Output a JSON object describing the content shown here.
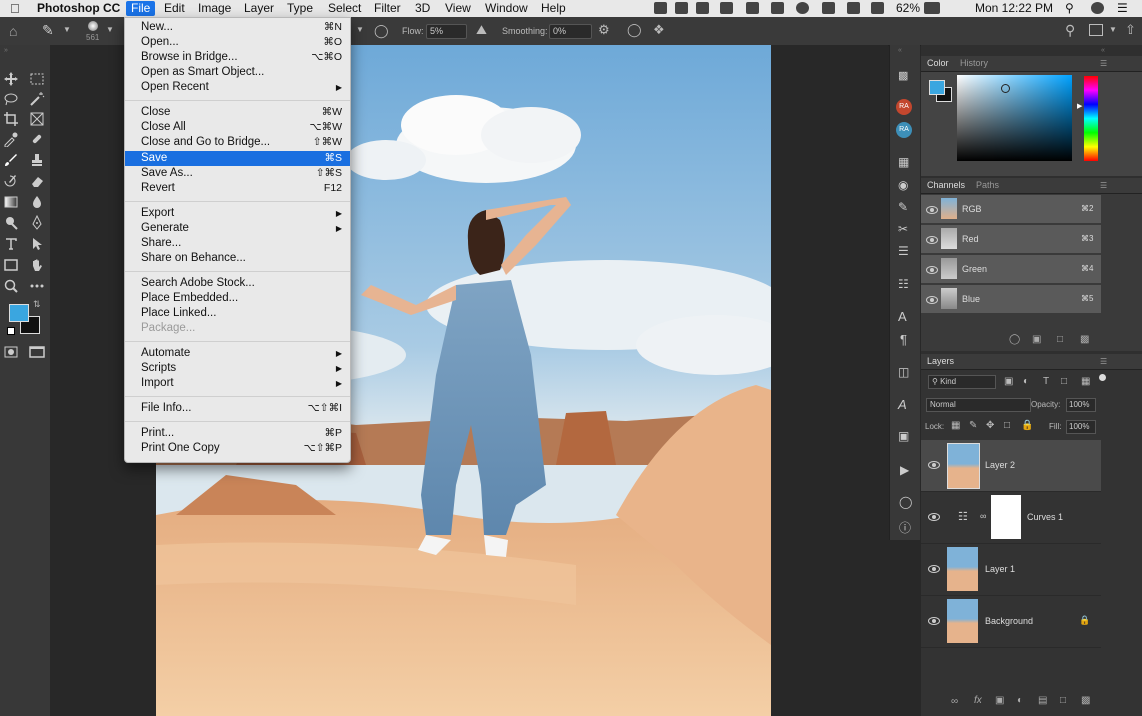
{
  "menubar": {
    "app_name": "Photoshop CC",
    "items": [
      "File",
      "Edit",
      "Image",
      "Layer",
      "Type",
      "Select",
      "Filter",
      "3D",
      "View",
      "Window",
      "Help"
    ],
    "battery": "62%",
    "clock": "Mon 12:22 PM"
  },
  "options_bar": {
    "brush_size": "561",
    "flow_label": "Flow:",
    "flow_value": "5%",
    "smoothing_label": "Smoothing:",
    "smoothing_value": "0%"
  },
  "file_menu": {
    "items": [
      {
        "label": "New...",
        "shortcut": "⌘N"
      },
      {
        "label": "Open...",
        "shortcut": "⌘O"
      },
      {
        "label": "Browse in Bridge...",
        "shortcut": "⌥⌘O"
      },
      {
        "label": "Open as Smart Object...",
        "shortcut": ""
      },
      {
        "label": "Open Recent",
        "shortcut": "",
        "submenu": true
      },
      {
        "label": "Close",
        "shortcut": "⌘W"
      },
      {
        "label": "Close All",
        "shortcut": "⌥⌘W"
      },
      {
        "label": "Close and Go to Bridge...",
        "shortcut": "⇧⌘W"
      },
      {
        "label": "Save",
        "shortcut": "⌘S",
        "highlighted": true
      },
      {
        "label": "Save As...",
        "shortcut": "⇧⌘S"
      },
      {
        "label": "Revert",
        "shortcut": "F12"
      },
      {
        "label": "Export",
        "shortcut": "",
        "submenu": true
      },
      {
        "label": "Generate",
        "shortcut": "",
        "submenu": true
      },
      {
        "label": "Share...",
        "shortcut": ""
      },
      {
        "label": "Share on Behance...",
        "shortcut": ""
      },
      {
        "label": "Search Adobe Stock...",
        "shortcut": ""
      },
      {
        "label": "Place Embedded...",
        "shortcut": ""
      },
      {
        "label": "Place Linked...",
        "shortcut": ""
      },
      {
        "label": "Package...",
        "shortcut": "",
        "disabled": true
      },
      {
        "label": "Automate",
        "shortcut": "",
        "submenu": true
      },
      {
        "label": "Scripts",
        "shortcut": "",
        "submenu": true
      },
      {
        "label": "Import",
        "shortcut": "",
        "submenu": true
      },
      {
        "label": "File Info...",
        "shortcut": "⌥⇧⌘I"
      },
      {
        "label": "Print...",
        "shortcut": "⌘P"
      },
      {
        "label": "Print One Copy",
        "shortcut": "⌥⇧⌘P"
      }
    ]
  },
  "color_panel": {
    "tabs": [
      "Color",
      "History"
    ],
    "fg_color": "#3aa6e0",
    "bg_color": "#111111"
  },
  "history_icons": [
    "RA",
    "RA"
  ],
  "channels_panel": {
    "tabs": [
      "Channels",
      "Paths"
    ],
    "channels": [
      {
        "name": "RGB",
        "shortcut": "⌘2"
      },
      {
        "name": "Red",
        "shortcut": "⌘3"
      },
      {
        "name": "Green",
        "shortcut": "⌘4"
      },
      {
        "name": "Blue",
        "shortcut": "⌘5"
      }
    ]
  },
  "layers_panel": {
    "title": "Layers",
    "filter_kind": "Kind",
    "blend_mode": "Normal",
    "opacity_label": "Opacity:",
    "opacity_value": "100%",
    "lock_label": "Lock:",
    "fill_label": "Fill:",
    "fill_value": "100%",
    "layers": [
      {
        "name": "Layer 2",
        "type": "photo",
        "selected": true
      },
      {
        "name": "Curves 1",
        "type": "adjustment",
        "selected": false
      },
      {
        "name": "Layer 1",
        "type": "photo",
        "selected": false
      },
      {
        "name": "Background",
        "type": "photo",
        "selected": false,
        "locked": true
      }
    ]
  }
}
